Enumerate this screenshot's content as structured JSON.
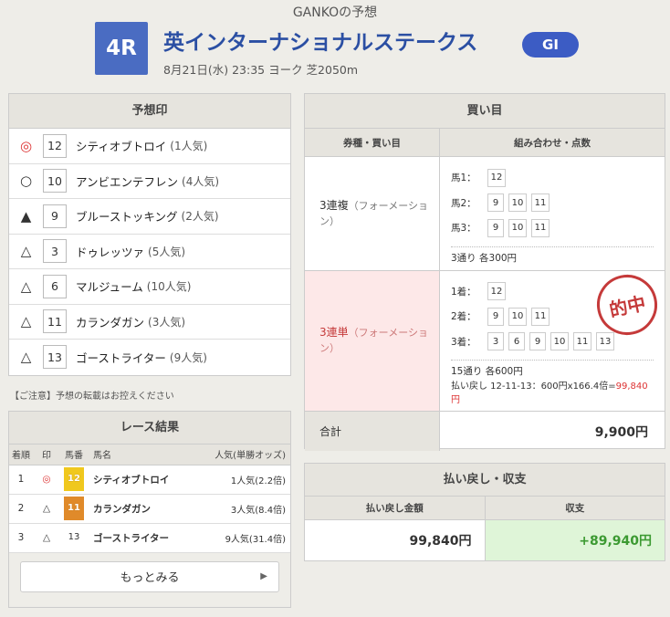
{
  "header": {
    "title": "GANKOの予想",
    "race_number": "4R",
    "race_name": "英インターナショナルステークス",
    "grade": "GI",
    "meta": "8月21日(水) 23:35 ヨーク 芝2050m"
  },
  "predictions": {
    "title": "予想印",
    "rows": [
      {
        "mark": "◎",
        "num": "12",
        "name": "シティオブトロイ",
        "pop": "(1人気)"
      },
      {
        "mark": "○",
        "num": "10",
        "name": "アンビエンテフレン",
        "pop": "(4人気)"
      },
      {
        "mark": "▲",
        "num": "9",
        "name": "ブルーストッキング",
        "pop": "(2人気)"
      },
      {
        "mark": "△",
        "num": "3",
        "name": "ドゥレッツァ",
        "pop": "(5人気)"
      },
      {
        "mark": "△",
        "num": "6",
        "name": "マルジューム",
        "pop": "(10人気)"
      },
      {
        "mark": "△",
        "num": "11",
        "name": "カランダガン",
        "pop": "(3人気)"
      },
      {
        "mark": "△",
        "num": "13",
        "name": "ゴーストライター",
        "pop": "(9人気)"
      }
    ]
  },
  "caution": "【ご注意】予想の転載はお控えください",
  "results": {
    "title": "レース結果",
    "headers": {
      "rank": "着順",
      "mark": "印",
      "num": "馬番",
      "name": "馬名",
      "odds": "人気(単勝オッズ)"
    },
    "rows": [
      {
        "rank": "1",
        "mark": "◎",
        "num": "12",
        "name": "シティオブトロイ",
        "odds": "1人気(2.2倍)",
        "color": "#f0c81e"
      },
      {
        "rank": "2",
        "mark": "△",
        "num": "11",
        "name": "カランダガン",
        "odds": "3人気(8.4倍)",
        "color": "#e08a2a"
      },
      {
        "rank": "3",
        "mark": "△",
        "num": "13",
        "name": "ゴーストライター",
        "odds": "9人気(31.4倍)",
        "color": ""
      }
    ],
    "more_label": "もっとみる"
  },
  "bets": {
    "title": "買い目",
    "col_type": "券種・買い目",
    "col_combo": "組み合わせ・点数",
    "tickets": [
      {
        "type": "3連複",
        "sub": "（フォーメーション）",
        "lines": [
          {
            "label": "馬1",
            "nums": [
              "12"
            ]
          },
          {
            "label": "馬2",
            "nums": [
              "9",
              "10",
              "11"
            ]
          },
          {
            "label": "馬3",
            "nums": [
              "9",
              "10",
              "11"
            ]
          }
        ],
        "summary": "3通り 各300円"
      },
      {
        "type": "3連単",
        "sub": "（フォーメーション）",
        "lines": [
          {
            "label": "1着",
            "nums": [
              "12"
            ]
          },
          {
            "label": "2着",
            "nums": [
              "9",
              "10",
              "11"
            ]
          },
          {
            "label": "3着",
            "nums": [
              "3",
              "6",
              "9",
              "10",
              "11",
              "13"
            ]
          }
        ],
        "summary": "15通り 各600円",
        "payout_prefix": "払い戻し 12-11-13：600円x166.4倍=",
        "payout_value": "99,840円",
        "stamp": "的中"
      }
    ],
    "total_label": "合計",
    "total_value": "9,900円"
  },
  "payout": {
    "title": "払い戻し・収支",
    "col_refund": "払い戻し金額",
    "col_balance": "収支",
    "refund": "99,840円",
    "balance": "+89,940円"
  },
  "colors": {
    "accent_blue": "#2b4fa3",
    "hit_bg": "#fde8e8",
    "hit_red": "#c53a3a",
    "profit_green": "#3c9a32"
  }
}
